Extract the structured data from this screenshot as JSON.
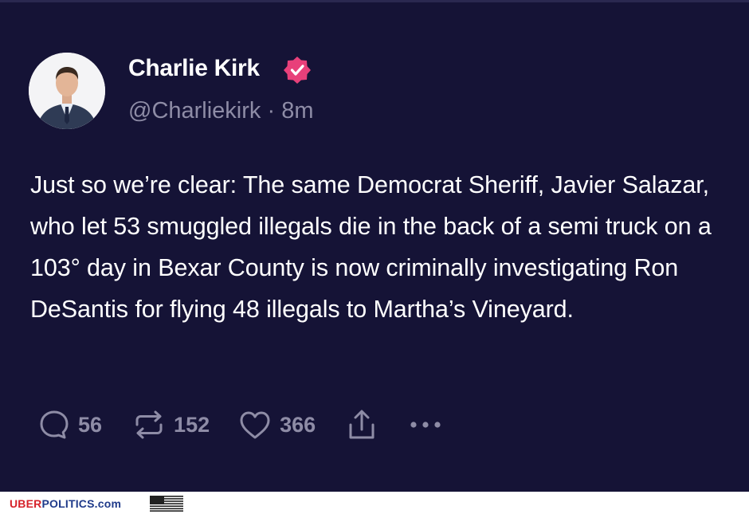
{
  "post": {
    "author_name": "Charlie Kirk",
    "handle": "@Charliekirk",
    "separator": "·",
    "time": "8m",
    "verified_color": "#e8407a",
    "text": "Just so we’re clear: The same Democrat Sheriff, Javier Salazar, who let 53 smuggled illegals die in the back of a semi truck on a 103° day in Bexar County is now criminally investigating Ron DeSantis for flying 48 illegals to Martha’s Vineyard."
  },
  "actions": {
    "replies": "56",
    "reposts": "152",
    "likes": "366",
    "reply_icon": "comment-icon",
    "repost_icon": "repost-icon",
    "like_icon": "heart-icon",
    "share_icon": "share-icon",
    "more_icon": "more-icon"
  },
  "footer": {
    "brand_part1": "UBER",
    "brand_part2": "POLITICS.com",
    "flag_icon": "us-flag-icon"
  },
  "colors": {
    "background": "#151336",
    "muted_text": "#8e8ca6",
    "text": "#ffffff",
    "brand_red": "#d6222a",
    "brand_blue": "#1f3a8a"
  }
}
